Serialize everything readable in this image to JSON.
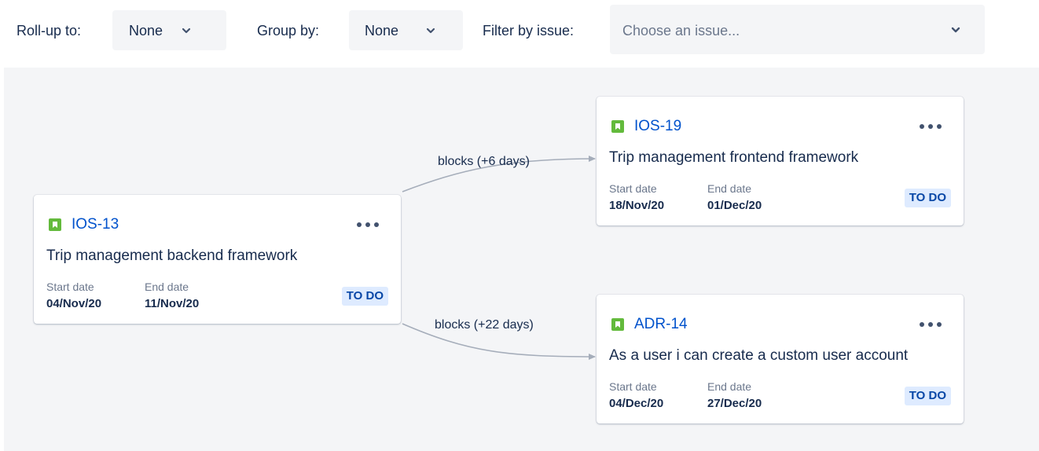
{
  "toolbar": {
    "rollup_label": "Roll-up to:",
    "rollup_value": "None",
    "groupby_label": "Group by:",
    "groupby_value": "None",
    "filter_label": "Filter by issue:",
    "filter_placeholder": "Choose an issue..."
  },
  "issues": [
    {
      "key": "IOS-13",
      "summary": "Trip management backend framework",
      "start_label": "Start date",
      "start_date": "04/Nov/20",
      "end_label": "End date",
      "end_date": "11/Nov/20",
      "status": "TO DO"
    },
    {
      "key": "IOS-19",
      "summary": "Trip management frontend framework",
      "start_label": "Start date",
      "start_date": "18/Nov/20",
      "end_label": "End date",
      "end_date": "01/Dec/20",
      "status": "TO DO"
    },
    {
      "key": "ADR-14",
      "summary": "As a user i can create a custom user account",
      "start_label": "Start date",
      "start_date": "04/Dec/20",
      "end_label": "End date",
      "end_date": "27/Dec/20",
      "status": "TO DO"
    }
  ],
  "links": [
    {
      "label": "blocks (+6 days)"
    },
    {
      "label": "blocks (+22 days)"
    }
  ],
  "colors": {
    "story_icon": "#63BA3C",
    "issue_key": "#0052CC",
    "status_bg": "#DEEBFF",
    "status_text": "#0747A6",
    "canvas_bg": "#F4F5F7",
    "edge": "#A5ADBA"
  },
  "icons": {
    "chevron": "chevron-down-icon",
    "issue_type": "story-icon",
    "more": "more-icon"
  }
}
